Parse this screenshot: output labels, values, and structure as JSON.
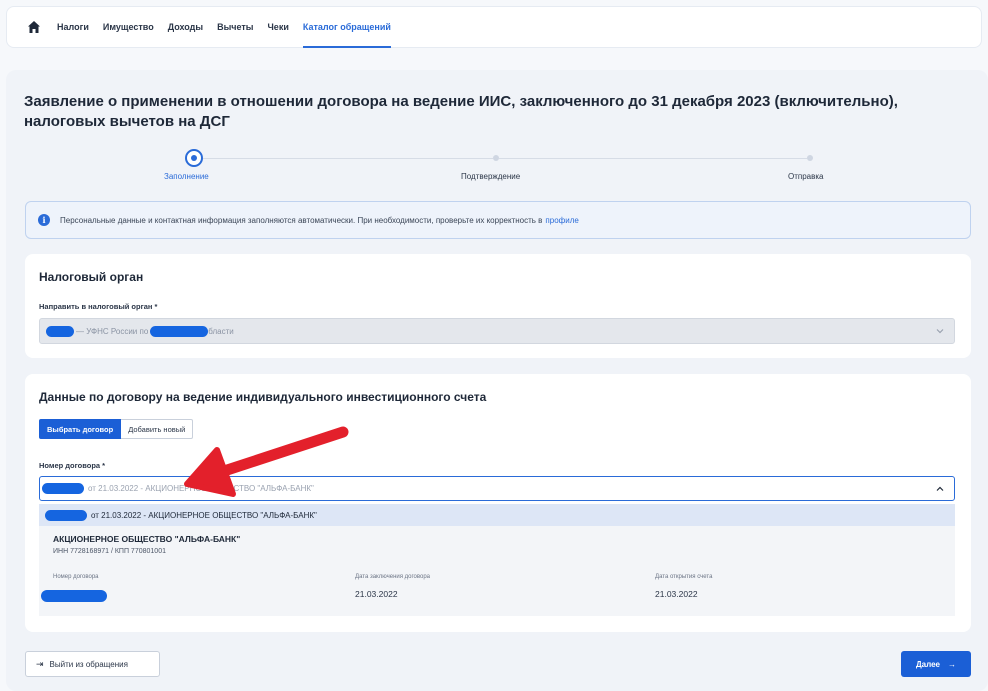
{
  "nav": {
    "items": [
      {
        "label": "Налоги"
      },
      {
        "label": "Имущество"
      },
      {
        "label": "Доходы"
      },
      {
        "label": "Вычеты"
      },
      {
        "label": "Чеки"
      },
      {
        "label": "Каталог обращений"
      }
    ],
    "active_index": 5
  },
  "page": {
    "title": "Заявление о применении в отношении договора на ведение ИИС, заключенного до 31 декабря 2023 (включительно), налоговых вычетов на ДСГ"
  },
  "stepper": {
    "steps": [
      {
        "label": "Заполнение",
        "state": "current"
      },
      {
        "label": "Подтверждение",
        "state": "pending"
      },
      {
        "label": "Отправка",
        "state": "pending"
      }
    ]
  },
  "info": {
    "text": "Персональные данные и контактная информация заполняются автоматически. При необходимости, проверьте их корректность в",
    "link": "профиле"
  },
  "tax_authority": {
    "title": "Налоговый орган",
    "field_label": "Направить в налоговый орган *",
    "value_part1": "— УФНС России по",
    "value_part2": "бласти"
  },
  "contract": {
    "title": "Данные по договору на ведение индивидуального инвестиционного счета",
    "toggle": {
      "selected": "Выбрать договор",
      "other": "Добавить новый"
    },
    "field_label": "Номер договора *",
    "select_value": "от 21.03.2022 - АКЦИОНЕРНОЕ ОБЩЕСТВО \"АЛЬФА-БАНК\"",
    "option": "от 21.03.2022 - АКЦИОНЕРНОЕ ОБЩЕСТВО \"АЛЬФА-БАНК\"",
    "details": {
      "org": "АКЦИОНЕРНОЕ ОБЩЕСТВО \"АЛЬФА-БАНК\"",
      "ids": "ИНН 7728168971 / КПП 770801001",
      "number_label": "Номер договора",
      "date_label": "Дата заключения договора",
      "date_value": "21.03.2022",
      "open_label": "Дата открытия счета",
      "open_value": "21.03.2022"
    }
  },
  "footer": {
    "exit_label": "Выйти из обращения",
    "next_label": "Далее"
  },
  "colors": {
    "accent": "#2a6bd8",
    "redaction": "#1565e0",
    "annotation_arrow": "#e3202b"
  }
}
